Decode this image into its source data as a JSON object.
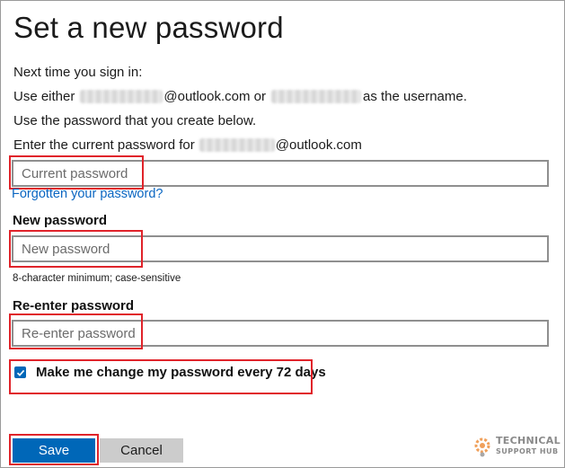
{
  "page": {
    "title": "Set a new password",
    "intro_line1": "Next time you sign in:",
    "intro_line2_prefix": "Use either",
    "intro_line2_email_suffix": "@outlook.com or",
    "intro_line2_suffix": "as the username.",
    "intro_line3": "Use the password that you create below.",
    "intro_line4_prefix": "Enter the current password for",
    "intro_line4_suffix": "@outlook.com"
  },
  "current_password": {
    "placeholder": "Current password",
    "forgot_link": "Forgotten your password?"
  },
  "new_password": {
    "label": "New password",
    "placeholder": "New password",
    "hint": "8-character minimum; case-sensitive"
  },
  "reenter_password": {
    "label": "Re-enter password",
    "placeholder": "Re-enter password"
  },
  "expiry_option": {
    "label": "Make me change my password every 72 days",
    "checked": true
  },
  "buttons": {
    "save": "Save",
    "cancel": "Cancel"
  },
  "watermark": {
    "line1": "TECHNICAL",
    "line2": "SUPPORT HUB"
  },
  "colors": {
    "accent": "#0067b8",
    "link": "#0a66c2",
    "highlight": "#e0232a"
  }
}
